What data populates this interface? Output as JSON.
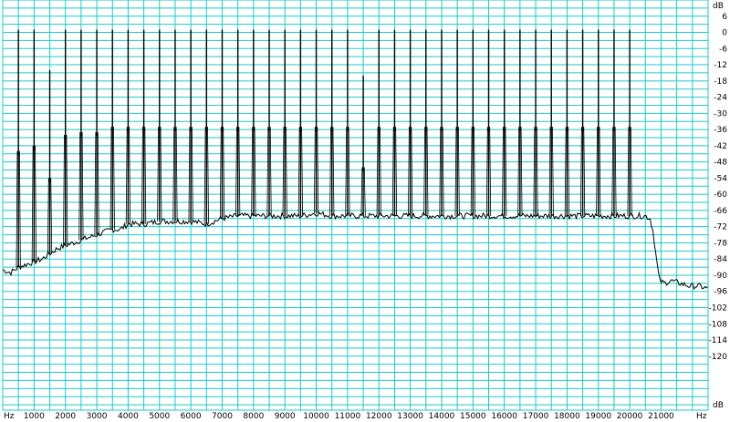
{
  "chart_data": {
    "type": "line",
    "title": "",
    "x_unit": "Hz",
    "y_unit": "dB",
    "xlim": [
      0,
      22500
    ],
    "ylim": [
      -140,
      12
    ],
    "x_ticks": [
      1000,
      2000,
      3000,
      4000,
      5000,
      6000,
      7000,
      8000,
      9000,
      10000,
      11000,
      12000,
      13000,
      14000,
      15000,
      16000,
      17000,
      18000,
      19000,
      20000,
      21000
    ],
    "x_tick_labels": [
      "1000",
      "2000",
      "3000",
      "4000",
      "5000",
      "6000",
      "7000",
      "8000",
      "9000",
      "10000",
      "11000",
      "12000",
      "13000",
      "14000",
      "15000",
      "16000",
      "17000",
      "18000",
      "19000",
      "20000",
      "21000"
    ],
    "y_ticks": [
      6,
      0,
      -6,
      -12,
      -18,
      -24,
      -30,
      -36,
      -42,
      -48,
      -54,
      -60,
      -66,
      -72,
      -78,
      -84,
      -90,
      -96,
      -102,
      -108,
      -114,
      -120
    ],
    "y_tick_labels": [
      "6",
      "0",
      "-6",
      "-12",
      "-18",
      "-24",
      "-30",
      "-36",
      "-42",
      "-48",
      "-54",
      "-60",
      "-66",
      "-72",
      "-78",
      "-84",
      "-90",
      "-96",
      "-102",
      "-108",
      "-114",
      "-120"
    ],
    "grid": true,
    "colors": {
      "grid": "#1ec8c8",
      "trace": "#000000",
      "background": "#ffffff"
    },
    "series": [
      {
        "kind": "noise_floor",
        "points": [
          [
            0,
            -88
          ],
          [
            250,
            -89
          ],
          [
            500,
            -87
          ],
          [
            750,
            -86
          ],
          [
            1000,
            -85
          ],
          [
            1250,
            -84
          ],
          [
            1500,
            -82
          ],
          [
            1750,
            -80
          ],
          [
            2000,
            -79
          ],
          [
            2250,
            -78
          ],
          [
            2500,
            -77
          ],
          [
            2750,
            -76
          ],
          [
            3000,
            -75
          ],
          [
            3250,
            -74
          ],
          [
            3500,
            -73
          ],
          [
            3750,
            -73
          ],
          [
            4000,
            -71
          ],
          [
            4500,
            -71
          ],
          [
            5000,
            -70
          ],
          [
            6000,
            -70
          ],
          [
            6500,
            -71
          ],
          [
            7000,
            -69
          ],
          [
            7500,
            -68
          ],
          [
            8000,
            -68
          ],
          [
            9000,
            -68
          ],
          [
            9500,
            -68
          ],
          [
            10000,
            -67
          ],
          [
            10500,
            -68
          ],
          [
            11000,
            -68
          ],
          [
            12000,
            -68
          ],
          [
            13000,
            -68
          ],
          [
            14000,
            -68
          ],
          [
            15000,
            -68
          ],
          [
            16000,
            -68
          ],
          [
            17000,
            -68
          ],
          [
            18000,
            -68
          ],
          [
            19000,
            -68
          ],
          [
            20000,
            -68
          ],
          [
            20500,
            -68
          ],
          [
            20650,
            -69
          ],
          [
            20750,
            -74
          ],
          [
            20850,
            -84
          ],
          [
            20950,
            -92
          ],
          [
            21100,
            -93
          ],
          [
            21300,
            -92
          ],
          [
            21600,
            -93
          ],
          [
            21900,
            -94
          ],
          [
            22200,
            -94
          ],
          [
            22500,
            -95
          ]
        ]
      },
      {
        "kind": "tones",
        "freq": [
          500,
          1000,
          1500,
          2000,
          2500,
          3000,
          3500,
          4000,
          4500,
          5000,
          5500,
          6000,
          6500,
          7000,
          7500,
          8000,
          8500,
          9000,
          9500,
          10000,
          10500,
          11000,
          11500,
          12000,
          12500,
          13000,
          13500,
          14000,
          14500,
          15000,
          15500,
          16000,
          16500,
          17000,
          17500,
          18000,
          18500,
          19000,
          19500,
          20000
        ],
        "peak_db": [
          1,
          1,
          -14,
          1,
          1,
          1,
          1,
          1,
          1,
          1,
          1,
          1,
          1,
          1,
          1,
          1,
          1,
          1,
          1,
          1,
          1,
          1,
          -16,
          1,
          1,
          1,
          1,
          1,
          1,
          1,
          1,
          1,
          1,
          1,
          1,
          1,
          1,
          1,
          1,
          1
        ],
        "shoulder_db": [
          -44,
          -42,
          -54,
          -38,
          -37,
          -37,
          -35,
          -35,
          -35,
          -35,
          -35,
          -35,
          -35,
          -35,
          -35,
          -35,
          -35,
          -35,
          -35,
          -35,
          -35,
          -35,
          -50,
          -35,
          -35,
          -35,
          -35,
          -35,
          -35,
          -35,
          -35,
          -35,
          -35,
          -35,
          -35,
          -35,
          -35,
          -35,
          -35,
          -35
        ]
      }
    ]
  }
}
